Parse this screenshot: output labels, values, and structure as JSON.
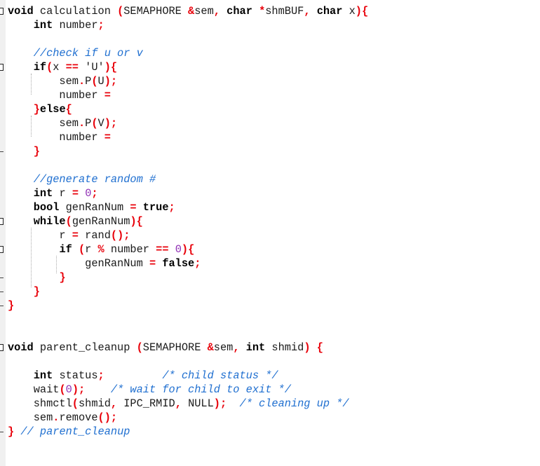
{
  "editor": {
    "language": "C++",
    "colors": {
      "gutter": "#f0f0f0",
      "keyword": "#000000",
      "operator": "#e8000a",
      "number": "#8e2bb3",
      "comment": "#1f6fd0",
      "text": "#1a1a1a"
    },
    "lines": [
      [
        [
          "kw",
          "void"
        ],
        [
          "t",
          " calculation "
        ],
        [
          "op",
          "("
        ],
        [
          "t",
          "SEMAPHORE "
        ],
        [
          "op",
          "&"
        ],
        [
          "t",
          "sem"
        ],
        [
          "op",
          ","
        ],
        [
          "t",
          " "
        ],
        [
          "kw",
          "char"
        ],
        [
          "t",
          " "
        ],
        [
          "op",
          "*"
        ],
        [
          "t",
          "shmBUF"
        ],
        [
          "op",
          ","
        ],
        [
          "t",
          " "
        ],
        [
          "kw",
          "char"
        ],
        [
          "t",
          " x"
        ],
        [
          "op",
          "){"
        ]
      ],
      [
        [
          "t",
          "    "
        ],
        [
          "kw",
          "int"
        ],
        [
          "t",
          " number"
        ],
        [
          "op",
          ";"
        ]
      ],
      [],
      [
        [
          "t",
          "    "
        ],
        [
          "cm",
          "//check if u or v"
        ]
      ],
      [
        [
          "t",
          "    "
        ],
        [
          "kw",
          "if"
        ],
        [
          "op",
          "("
        ],
        [
          "t",
          "x "
        ],
        [
          "op",
          "=="
        ],
        [
          "t",
          " "
        ],
        [
          "str",
          "'U'"
        ],
        [
          "op",
          "){"
        ]
      ],
      [
        [
          "t",
          "        sem"
        ],
        [
          "op",
          "."
        ],
        [
          "t",
          "P"
        ],
        [
          "op",
          "("
        ],
        [
          "t",
          "U"
        ],
        [
          "op",
          ");"
        ]
      ],
      [
        [
          "t",
          "        number "
        ],
        [
          "op",
          "="
        ]
      ],
      [
        [
          "t",
          "    "
        ],
        [
          "op",
          "}"
        ],
        [
          "kw",
          "else"
        ],
        [
          "op",
          "{"
        ]
      ],
      [
        [
          "t",
          "        sem"
        ],
        [
          "op",
          "."
        ],
        [
          "t",
          "P"
        ],
        [
          "op",
          "("
        ],
        [
          "t",
          "V"
        ],
        [
          "op",
          ");"
        ]
      ],
      [
        [
          "t",
          "        number "
        ],
        [
          "op",
          "="
        ]
      ],
      [
        [
          "t",
          "    "
        ],
        [
          "op",
          "}"
        ]
      ],
      [],
      [
        [
          "t",
          "    "
        ],
        [
          "cm",
          "//generate random #"
        ]
      ],
      [
        [
          "t",
          "    "
        ],
        [
          "kw",
          "int"
        ],
        [
          "t",
          " r "
        ],
        [
          "op",
          "="
        ],
        [
          "t",
          " "
        ],
        [
          "num",
          "0"
        ],
        [
          "op",
          ";"
        ]
      ],
      [
        [
          "t",
          "    "
        ],
        [
          "kw",
          "bool"
        ],
        [
          "t",
          " genRanNum "
        ],
        [
          "op",
          "="
        ],
        [
          "t",
          " "
        ],
        [
          "kw",
          "true"
        ],
        [
          "op",
          ";"
        ]
      ],
      [
        [
          "t",
          "    "
        ],
        [
          "kw",
          "while"
        ],
        [
          "op",
          "("
        ],
        [
          "t",
          "genRanNum"
        ],
        [
          "op",
          "){"
        ]
      ],
      [
        [
          "t",
          "        r "
        ],
        [
          "op",
          "="
        ],
        [
          "t",
          " rand"
        ],
        [
          "op",
          "();"
        ]
      ],
      [
        [
          "t",
          "        "
        ],
        [
          "kw",
          "if"
        ],
        [
          "t",
          " "
        ],
        [
          "op",
          "("
        ],
        [
          "t",
          "r "
        ],
        [
          "op",
          "%"
        ],
        [
          "t",
          " number "
        ],
        [
          "op",
          "=="
        ],
        [
          "t",
          " "
        ],
        [
          "num",
          "0"
        ],
        [
          "op",
          "){"
        ]
      ],
      [
        [
          "t",
          "            genRanNum "
        ],
        [
          "op",
          "="
        ],
        [
          "t",
          " "
        ],
        [
          "kw",
          "false"
        ],
        [
          "op",
          ";"
        ]
      ],
      [
        [
          "t",
          "        "
        ],
        [
          "op",
          "}"
        ]
      ],
      [
        [
          "t",
          "    "
        ],
        [
          "op",
          "}"
        ]
      ],
      [
        [
          "op",
          "}"
        ]
      ],
      [],
      [],
      [
        [
          "kw",
          "void"
        ],
        [
          "t",
          " parent_cleanup "
        ],
        [
          "op",
          "("
        ],
        [
          "t",
          "SEMAPHORE "
        ],
        [
          "op",
          "&"
        ],
        [
          "t",
          "sem"
        ],
        [
          "op",
          ","
        ],
        [
          "t",
          " "
        ],
        [
          "kw",
          "int"
        ],
        [
          "t",
          " shmid"
        ],
        [
          "op",
          ")"
        ],
        [
          "t",
          " "
        ],
        [
          "op",
          "{"
        ]
      ],
      [],
      [
        [
          "t",
          "    "
        ],
        [
          "kw",
          "int"
        ],
        [
          "t",
          " status"
        ],
        [
          "op",
          ";"
        ],
        [
          "t",
          "         "
        ],
        [
          "cm",
          "/* child status */"
        ]
      ],
      [
        [
          "t",
          "    wait"
        ],
        [
          "op",
          "("
        ],
        [
          "num",
          "0"
        ],
        [
          "op",
          ");"
        ],
        [
          "t",
          "    "
        ],
        [
          "cm",
          "/* wait for child to exit */"
        ]
      ],
      [
        [
          "t",
          "    shmctl"
        ],
        [
          "op",
          "("
        ],
        [
          "t",
          "shmid"
        ],
        [
          "op",
          ","
        ],
        [
          "t",
          " IPC_RMID"
        ],
        [
          "op",
          ","
        ],
        [
          "t",
          " NULL"
        ],
        [
          "op",
          ");"
        ],
        [
          "t",
          "  "
        ],
        [
          "cm",
          "/* cleaning up */"
        ]
      ],
      [
        [
          "t",
          "    sem"
        ],
        [
          "op",
          "."
        ],
        [
          "t",
          "remove"
        ],
        [
          "op",
          "();"
        ]
      ],
      [
        [
          "op",
          "}"
        ],
        [
          "t",
          " "
        ],
        [
          "cm",
          "// parent_cleanup"
        ]
      ]
    ]
  }
}
